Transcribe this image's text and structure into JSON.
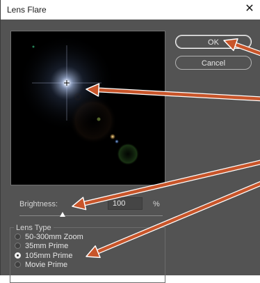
{
  "window": {
    "title": "Lens Flare",
    "close_glyph": "✕"
  },
  "buttons": {
    "ok": "OK",
    "cancel": "Cancel"
  },
  "brightness": {
    "label": "Brightness:",
    "value": "100",
    "unit": "%",
    "slider_level": 0.3
  },
  "lens_type": {
    "legend": "Lens Type",
    "options": [
      "50-300mm Zoom",
      "35mm Prime",
      "105mm Prime",
      "Movie Prime"
    ],
    "selected": "105mm Prime"
  },
  "annotation_color": "#c8552a",
  "icons": {
    "flare_center": "crosshair-icon"
  }
}
